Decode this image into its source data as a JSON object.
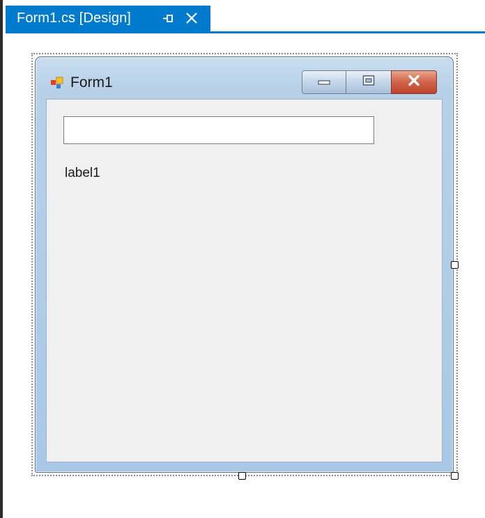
{
  "document_tab": {
    "title": "Form1.cs [Design]",
    "pin_icon": "pin-icon",
    "close_icon": "close-icon"
  },
  "form": {
    "title": "Form1",
    "app_icon": "windows-form-icon",
    "buttons": {
      "minimize_icon": "minimize-icon",
      "maximize_icon": "maximize-icon",
      "close_icon": "close-icon"
    }
  },
  "controls": {
    "textbox_value": "",
    "label_text": "label1"
  },
  "colors": {
    "accent": "#007acc",
    "close_button": "#c9523a",
    "client_background": "#f0f0f0"
  }
}
